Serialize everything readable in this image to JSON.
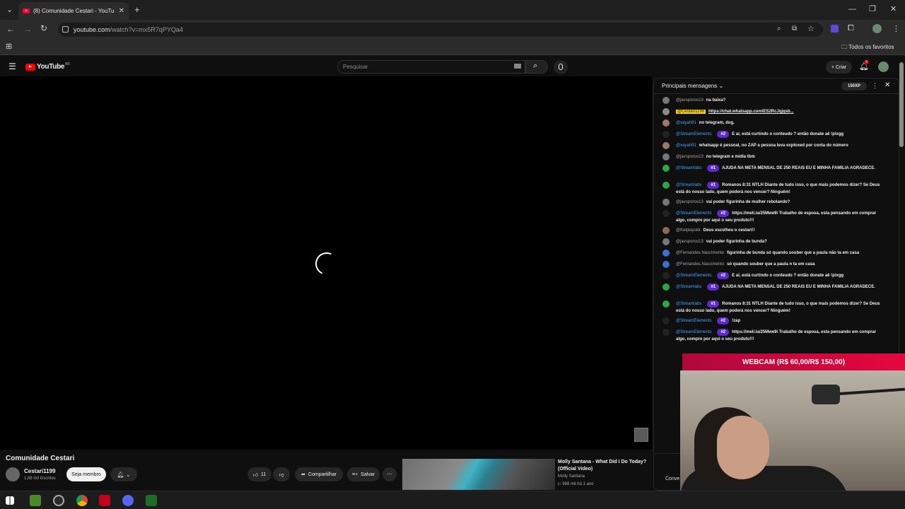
{
  "browser": {
    "tab_title": "(8) Comunidade Cestari - YouTu",
    "url_host": "youtube.com",
    "url_path": "/watch?v=mx5R7qPYQa4",
    "bookmarks_all": "Todos os favoritos"
  },
  "youtube": {
    "logo_text": "YouTube",
    "logo_region": "BR",
    "search_placeholder": "Pesquisar",
    "create_label": "+ Criar",
    "notification_count": "9"
  },
  "video": {
    "title": "Comunidade Cestari",
    "channel": "Cestari1199",
    "subscribers": "1,88 mil inscritos",
    "join_label": "Seja membro",
    "likes": "11",
    "share_label": "Compartilhar",
    "save_label": "Salvar"
  },
  "recommended": {
    "title": "Molly Santana - What Did I Do Today? (Official Video)",
    "channel": "Molly Santana",
    "stats": "▷ 968 mil  há 1 ano"
  },
  "chat": {
    "title": "Principais mensagens",
    "xp_badge": "150XP",
    "converse_label": "Conve",
    "messages": [
      {
        "author": "@javsporoo13",
        "text": "na baixa?",
        "style": "grey",
        "avatar": "#777"
      },
      {
        "author": "@Cestari1199",
        "text": "https://chat.whatsapp.com/ES2RcJqjqsb...",
        "style": "hl",
        "link": true,
        "avatar": "#8a8a8a"
      },
      {
        "author": "@xayah91",
        "text": "no telegram, dog.",
        "style": "blue",
        "avatar": "#9a7a66"
      },
      {
        "author": "@StreamElements",
        "rank": "#2",
        "text": "E aí, está curtindo o conteudo ? então donate aê !pixgg",
        "style": "blue",
        "avatar": "#222"
      },
      {
        "author": "@xayah91",
        "text": "whatsapp é pessoal, no ZAP a pessoa leva exploxed por conta do número",
        "style": "blue",
        "avatar": "#9a7a66"
      },
      {
        "author": "@javsporoo13",
        "text": "no telegram e mídia tbm",
        "style": "grey",
        "avatar": "#777"
      },
      {
        "author": "@Streamlabs",
        "rank": "#1",
        "text": "AJUDA NA META MENSAL DE 250 REAIS EU E MINHA FAMILIA AGRADECE.",
        "style": "blue",
        "avatar": "#2ba640"
      },
      {
        "author": "@Streamlabs",
        "rank": "#1",
        "text": "Romanos 8:31 NTLH Diante de tudo isso, o que mais podemos dizer? Se Deus está do nosso lado, quem poderá nos vencer? Ninguém!",
        "style": "blue",
        "avatar": "#2ba640"
      },
      {
        "author": "@javsporoo13",
        "text": "vai poder figurinha de mulher rebolando?",
        "style": "grey",
        "avatar": "#777"
      },
      {
        "author": "@StreamElements",
        "rank": "#2",
        "text": "https://meli.la/25Mwe9i Trabalho de esposa, esta pensando em comprar algo, compre por aqui o seu produto!!!",
        "style": "blue",
        "avatar": "#222"
      },
      {
        "author": "@Kelplayskk",
        "text": "Deus escolheu o cestari!!",
        "style": "grey",
        "avatar": "#8a6a55"
      },
      {
        "author": "@javsporoo13",
        "text": "vai poder figurinha de bunda?",
        "style": "grey",
        "avatar": "#777"
      },
      {
        "author": "@Fernandes.Nascimento",
        "text": "figurinha de bunda só quando souber que a paula não ta em casa",
        "style": "grey",
        "avatar": "#3b6fd4"
      },
      {
        "author": "@Fernandes.Nascimento",
        "text": "só quando souber que a paula n ta em casa",
        "style": "grey",
        "avatar": "#3b6fd4"
      },
      {
        "author": "@StreamElements",
        "rank": "#2",
        "text": "E aí, está curtindo o conteudo ? então donate aê !pixgg",
        "style": "blue",
        "avatar": "#222"
      },
      {
        "author": "@Streamlabs",
        "rank": "#1",
        "text": "AJUDA NA META MENSAL DE 250 REAIS EU E MINHA FAMILIA AGRADECE.",
        "style": "blue",
        "avatar": "#2ba640"
      },
      {
        "author": "@Streamlabs",
        "rank": "#1",
        "text": "Romanos 8:31 NTLH Diante de tudo isso, o que mais podemos dizer? Se Deus está do nosso lado, quem poderá nos vencer? Ninguém!",
        "style": "blue",
        "avatar": "#2ba640"
      },
      {
        "author": "@StreamElements",
        "rank": "#2",
        "text": "!zap",
        "style": "blue",
        "avatar": "#222"
      },
      {
        "author": "@StreamElements",
        "rank": "#2",
        "text": "https://meli.la/25Mwe9i Trabalho de esposa, esta pensando em comprar algo, compre por aqui o seu produto!!!",
        "style": "blue",
        "avatar": "#222"
      }
    ]
  },
  "webcam": {
    "banner": "WEBCAM (R$ 60,00/R$ 150,00)"
  },
  "colors": {
    "accent": "#ff0033",
    "chat_blue": "#3ea6ff",
    "rank_purple": "#5b2bd1",
    "banner_red": "#e5073f"
  }
}
